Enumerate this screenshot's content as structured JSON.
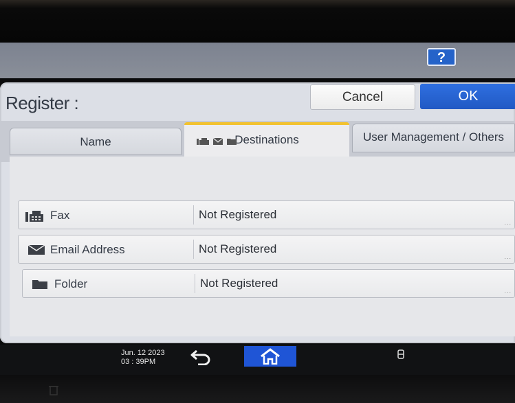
{
  "header": {
    "help_label": "?"
  },
  "dialog": {
    "title": "Register :",
    "cancel_label": "Cancel",
    "ok_label": "OK"
  },
  "tabs": [
    {
      "label": "Name",
      "active": false
    },
    {
      "label": "Destinations",
      "active": true
    },
    {
      "label": "User Management / Others",
      "active": false
    }
  ],
  "destinations": [
    {
      "label": "Fax",
      "value": "Not Registered",
      "icon": "fax-icon"
    },
    {
      "label": "Email Address",
      "value": "Not Registered",
      "icon": "envelope-icon"
    },
    {
      "label": "Folder",
      "value": "Not Registered",
      "icon": "folder-icon"
    }
  ],
  "status": {
    "date": "Jun. 12 2023",
    "time": "03 : 39PM"
  },
  "colors": {
    "ok_button": "#2159c4",
    "home_button": "#1f55d6",
    "active_tab_accent": "#f2c230",
    "help_button": "#2563c9"
  }
}
